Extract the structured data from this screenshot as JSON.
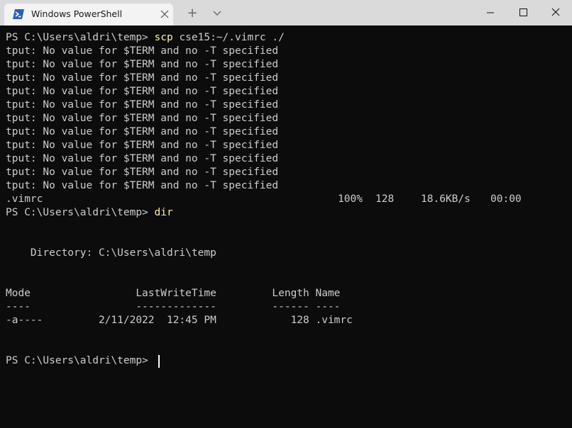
{
  "window": {
    "tab_title": "Windows PowerShell",
    "new_tab_label": "+"
  },
  "terminal": {
    "prompt": "PS C:\\Users\\aldri\\temp> ",
    "cmd_scp": "scp",
    "scp_args": " cse15:~/.vimrc ./",
    "tput_lines": [
      "tput: No value for $TERM and no -T specified",
      "tput: No value for $TERM and no -T specified",
      "tput: No value for $TERM and no -T specified",
      "tput: No value for $TERM and no -T specified",
      "tput: No value for $TERM and no -T specified",
      "tput: No value for $TERM and no -T specified",
      "tput: No value for $TERM and no -T specified",
      "tput: No value for $TERM and no -T specified",
      "tput: No value for $TERM and no -T specified",
      "tput: No value for $TERM and no -T specified",
      "tput: No value for $TERM and no -T specified"
    ],
    "transfer": {
      "file": ".vimrc",
      "percent": "100%",
      "size": "128",
      "rate": "18.6KB/s",
      "eta": "00:00"
    },
    "cmd_dir": "dir",
    "directory_line": "    Directory: C:\\Users\\aldri\\temp",
    "table_header": "Mode                 LastWriteTime         Length Name",
    "table_rule": "----                 -------------         ------ ----",
    "table_rows": [
      "-a----         2/11/2022  12:45 PM            128 .vimrc"
    ]
  }
}
